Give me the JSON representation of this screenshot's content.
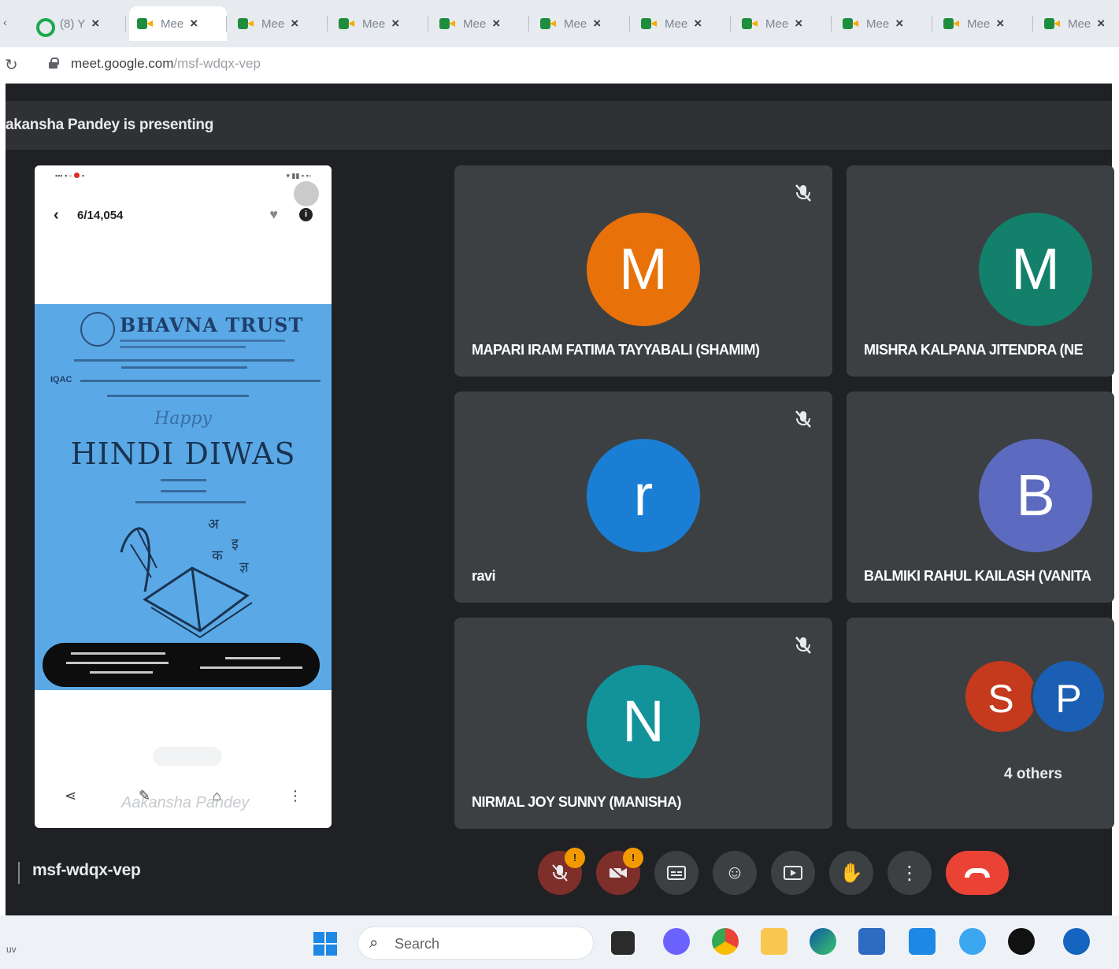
{
  "browser": {
    "tabs": [
      {
        "label": "(8) Y",
        "icon": "opera-icon",
        "active": false
      },
      {
        "label": "Mee",
        "icon": "google-meet-icon",
        "active": true
      },
      {
        "label": "Mee",
        "icon": "google-meet-icon",
        "active": false
      },
      {
        "label": "Mee",
        "icon": "google-meet-icon",
        "active": false
      },
      {
        "label": "Mee",
        "icon": "google-meet-icon",
        "active": false
      },
      {
        "label": "Mee",
        "icon": "google-meet-icon",
        "active": false
      },
      {
        "label": "Mee",
        "icon": "google-meet-icon",
        "active": false
      },
      {
        "label": "Mee",
        "icon": "google-meet-icon",
        "active": false
      },
      {
        "label": "Mee",
        "icon": "google-meet-icon",
        "active": false
      },
      {
        "label": "Mee",
        "icon": "google-meet-icon",
        "active": false
      },
      {
        "label": "Mee",
        "icon": "google-meet-icon",
        "active": false
      }
    ],
    "address": {
      "host": "meet.google.com",
      "path": "/msf-wdqx-vep"
    }
  },
  "meet": {
    "presenting_text": "akansha Pandey is presenting",
    "meeting_code": "msf-wdqx-vep",
    "presentation": {
      "counter": "6/14,054",
      "poster_org": "BHAVNA TRUST",
      "poster_iqac": "IQAC",
      "poster_happy": "Happy",
      "poster_title": "HINDI DIWAS",
      "watermark": "Aakansha Pandey"
    },
    "tiles": [
      {
        "initial": "M",
        "name": "MAPARI IRAM FATIMA TAYYABALI (SHAMIM)",
        "color": "#e8710a",
        "muted": true
      },
      {
        "initial": "M",
        "name": "MISHRA KALPANA JITENDRA (NE",
        "color": "#12806a",
        "muted": false
      },
      {
        "initial": "r",
        "name": "ravi",
        "color": "#1a7fd4",
        "muted": true
      },
      {
        "initial": "B",
        "name": "BALMIKI RAHUL KAILASH (VANITA",
        "color": "#5c6bc0",
        "muted": false
      },
      {
        "initial": "N",
        "name": "NIRMAL JOY SUNNY (MANISHA)",
        "color": "#12939a",
        "muted": true
      }
    ],
    "others": {
      "avatars": [
        {
          "initial": "S",
          "color": "#c5391c"
        },
        {
          "initial": "P",
          "color": "#1a5fb4"
        }
      ],
      "label": "4 others"
    },
    "controls": {
      "mic_badge": "!",
      "camera_badge": "!"
    }
  },
  "taskbar": {
    "left_text": "uv",
    "search_placeholder": "Search"
  },
  "colors": {
    "meet_bg": "#202124",
    "tile_bg": "#3c4043",
    "end_call": "#ea4335",
    "badge": "#f29900"
  }
}
